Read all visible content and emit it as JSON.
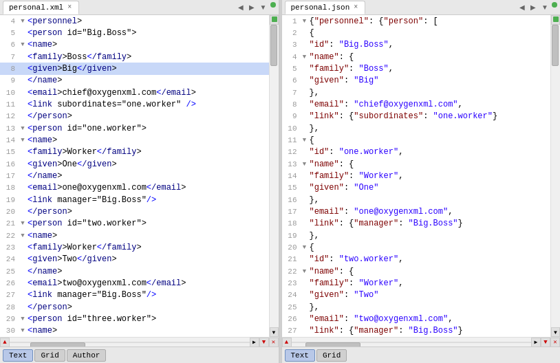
{
  "panels": {
    "xml": {
      "tab_label": "personal.xml",
      "tab_active": true,
      "lines": [
        {
          "num": 4,
          "fold": true,
          "content": "<personnel>",
          "type": "xml"
        },
        {
          "num": 5,
          "fold": false,
          "content": "    <person id=\"Big.Boss\">",
          "type": "xml"
        },
        {
          "num": 6,
          "fold": true,
          "content": "        <name>",
          "type": "xml"
        },
        {
          "num": 7,
          "fold": false,
          "content": "            <family>Boss</family>",
          "type": "xml"
        },
        {
          "num": 8,
          "fold": false,
          "content": "            <given>Big</given>",
          "type": "xml",
          "highlight": true
        },
        {
          "num": 9,
          "fold": false,
          "content": "        </name>",
          "type": "xml"
        },
        {
          "num": 10,
          "fold": false,
          "content": "        <email>chief@oxygenxml.com</email>",
          "type": "xml"
        },
        {
          "num": 11,
          "fold": false,
          "content": "        <link subordinates=\"one.worker\" />",
          "type": "xml"
        },
        {
          "num": 12,
          "fold": false,
          "content": "    </person>",
          "type": "xml"
        },
        {
          "num": 13,
          "fold": true,
          "content": "    <person id=\"one.worker\">",
          "type": "xml"
        },
        {
          "num": 14,
          "fold": true,
          "content": "        <name>",
          "type": "xml"
        },
        {
          "num": 15,
          "fold": false,
          "content": "            <family>Worker</family>",
          "type": "xml"
        },
        {
          "num": 16,
          "fold": false,
          "content": "            <given>One</given>",
          "type": "xml"
        },
        {
          "num": 17,
          "fold": false,
          "content": "        </name>",
          "type": "xml"
        },
        {
          "num": 18,
          "fold": false,
          "content": "        <email>one@oxygenxml.com</email>",
          "type": "xml"
        },
        {
          "num": 19,
          "fold": false,
          "content": "        <link manager=\"Big.Boss\"/>",
          "type": "xml"
        },
        {
          "num": 20,
          "fold": false,
          "content": "    </person>",
          "type": "xml"
        },
        {
          "num": 21,
          "fold": true,
          "content": "    <person id=\"two.worker\">",
          "type": "xml"
        },
        {
          "num": 22,
          "fold": true,
          "content": "        <name>",
          "type": "xml"
        },
        {
          "num": 23,
          "fold": false,
          "content": "            <family>Worker</family>",
          "type": "xml"
        },
        {
          "num": 24,
          "fold": false,
          "content": "            <given>Two</given>",
          "type": "xml"
        },
        {
          "num": 25,
          "fold": false,
          "content": "        </name>",
          "type": "xml"
        },
        {
          "num": 26,
          "fold": false,
          "content": "        <email>two@oxygenxml.com</email>",
          "type": "xml"
        },
        {
          "num": 27,
          "fold": false,
          "content": "        <link manager=\"Big.Boss\"/>",
          "type": "xml"
        },
        {
          "num": 28,
          "fold": false,
          "content": "    </person>",
          "type": "xml"
        },
        {
          "num": 29,
          "fold": true,
          "content": "    <person id=\"three.worker\">",
          "type": "xml"
        },
        {
          "num": 30,
          "fold": true,
          "content": "        <name>",
          "type": "xml"
        }
      ],
      "status_buttons": [
        {
          "label": "Text",
          "active": true
        },
        {
          "label": "Grid",
          "active": false
        },
        {
          "label": "Author",
          "active": false
        }
      ]
    },
    "json": {
      "tab_label": "personal.json",
      "tab_active": true,
      "lines": [
        {
          "num": 1,
          "content": "{\"personnel\": {\"person\": [",
          "type": "json"
        },
        {
          "num": 2,
          "content": "    {",
          "type": "json"
        },
        {
          "num": 3,
          "content": "        \"id\": \"Big.Boss\",",
          "type": "json"
        },
        {
          "num": 4,
          "content": "        \"name\": {",
          "type": "json"
        },
        {
          "num": 5,
          "content": "            \"family\": \"Boss\",",
          "type": "json"
        },
        {
          "num": 6,
          "content": "            \"given\": \"Big\"",
          "type": "json"
        },
        {
          "num": 7,
          "content": "        },",
          "type": "json"
        },
        {
          "num": 8,
          "content": "        \"email\": \"chief@oxygenxml.com\",",
          "type": "json"
        },
        {
          "num": 9,
          "content": "        \"link\": {\"subordinates\": \"one.worker\"}",
          "type": "json"
        },
        {
          "num": 10,
          "content": "    },",
          "type": "json"
        },
        {
          "num": 11,
          "content": "    {",
          "type": "json"
        },
        {
          "num": 12,
          "content": "        \"id\": \"one.worker\",",
          "type": "json"
        },
        {
          "num": 13,
          "content": "        \"name\": {",
          "type": "json"
        },
        {
          "num": 14,
          "content": "            \"family\": \"Worker\",",
          "type": "json"
        },
        {
          "num": 15,
          "content": "            \"given\": \"One\"",
          "type": "json"
        },
        {
          "num": 16,
          "content": "        },",
          "type": "json"
        },
        {
          "num": 17,
          "content": "        \"email\": \"one@oxygenxml.com\",",
          "type": "json"
        },
        {
          "num": 18,
          "content": "        \"link\": {\"manager\": \"Big.Boss\"}",
          "type": "json"
        },
        {
          "num": 19,
          "content": "    },",
          "type": "json"
        },
        {
          "num": 20,
          "content": "    {",
          "type": "json"
        },
        {
          "num": 21,
          "content": "        \"id\": \"two.worker\",",
          "type": "json"
        },
        {
          "num": 22,
          "content": "        \"name\": {",
          "type": "json"
        },
        {
          "num": 23,
          "content": "            \"family\": \"Worker\",",
          "type": "json"
        },
        {
          "num": 24,
          "content": "            \"given\": \"Two\"",
          "type": "json"
        },
        {
          "num": 25,
          "content": "        },",
          "type": "json"
        },
        {
          "num": 26,
          "content": "        \"email\": \"two@oxygenxml.com\",",
          "type": "json"
        },
        {
          "num": 27,
          "content": "        \"link\": {\"manager\": \"Big.Boss\"}",
          "type": "json"
        }
      ],
      "status_buttons": [
        {
          "label": "Text",
          "active": true
        },
        {
          "label": "Grid",
          "active": false
        }
      ]
    }
  }
}
